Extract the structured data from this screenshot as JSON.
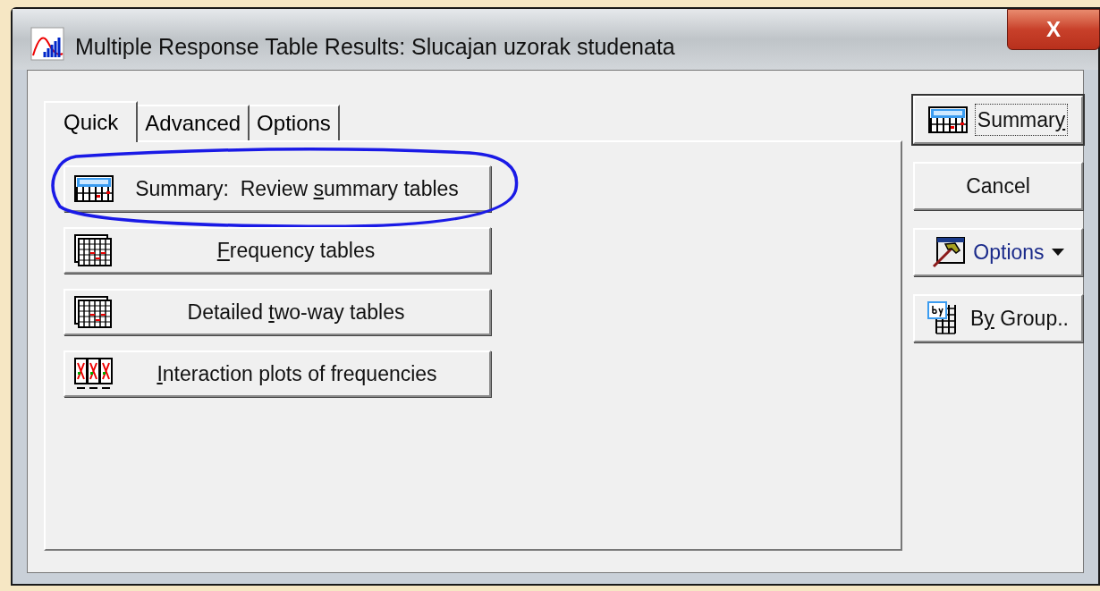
{
  "window": {
    "title": "Multiple Response Table Results: Slucajan uzorak studenata",
    "close": "X"
  },
  "tabs": [
    {
      "label": "Quick",
      "selected": true
    },
    {
      "label": "Advanced",
      "selected": false
    },
    {
      "label": "Options",
      "selected": false
    }
  ],
  "quick_buttons": [
    {
      "kind": "summary",
      "label_parts": [
        {
          "text": "Summary:  Review ",
          "underlined": false
        },
        {
          "text": "s",
          "underlined": true
        },
        {
          "text": "ummary tables",
          "underlined": false
        }
      ],
      "circled": true
    },
    {
      "kind": "table",
      "label_parts": [
        {
          "text": "F",
          "underlined": true
        },
        {
          "text": "requency tables",
          "underlined": false
        }
      ],
      "circled": false
    },
    {
      "kind": "table",
      "label_parts": [
        {
          "text": "Detailed ",
          "underlined": false
        },
        {
          "text": "t",
          "underlined": true
        },
        {
          "text": "wo-way tables",
          "underlined": false
        }
      ],
      "circled": false
    },
    {
      "kind": "plot",
      "label_parts": [
        {
          "text": "I",
          "underlined": true
        },
        {
          "text": "nteraction plots of frequencies",
          "underlined": false
        }
      ],
      "circled": false
    }
  ],
  "side_buttons": [
    {
      "kind": "summary",
      "label_parts": [
        {
          "text": "Summar",
          "underlined": false
        },
        {
          "text": "y",
          "underlined": true
        }
      ],
      "focused": true
    },
    {
      "kind": "plain",
      "label_parts": [
        {
          "text": "Cancel",
          "underlined": false
        }
      ],
      "focused": false
    },
    {
      "kind": "options",
      "label_parts": [
        {
          "text": "Options",
          "underlined": false
        }
      ],
      "focused": false
    },
    {
      "kind": "group",
      "label_parts": [
        {
          "text": "B",
          "underlined": false
        },
        {
          "text": "y",
          "underlined": true
        },
        {
          "text": " Group..",
          "underlined": false
        }
      ],
      "focused": false
    }
  ]
}
